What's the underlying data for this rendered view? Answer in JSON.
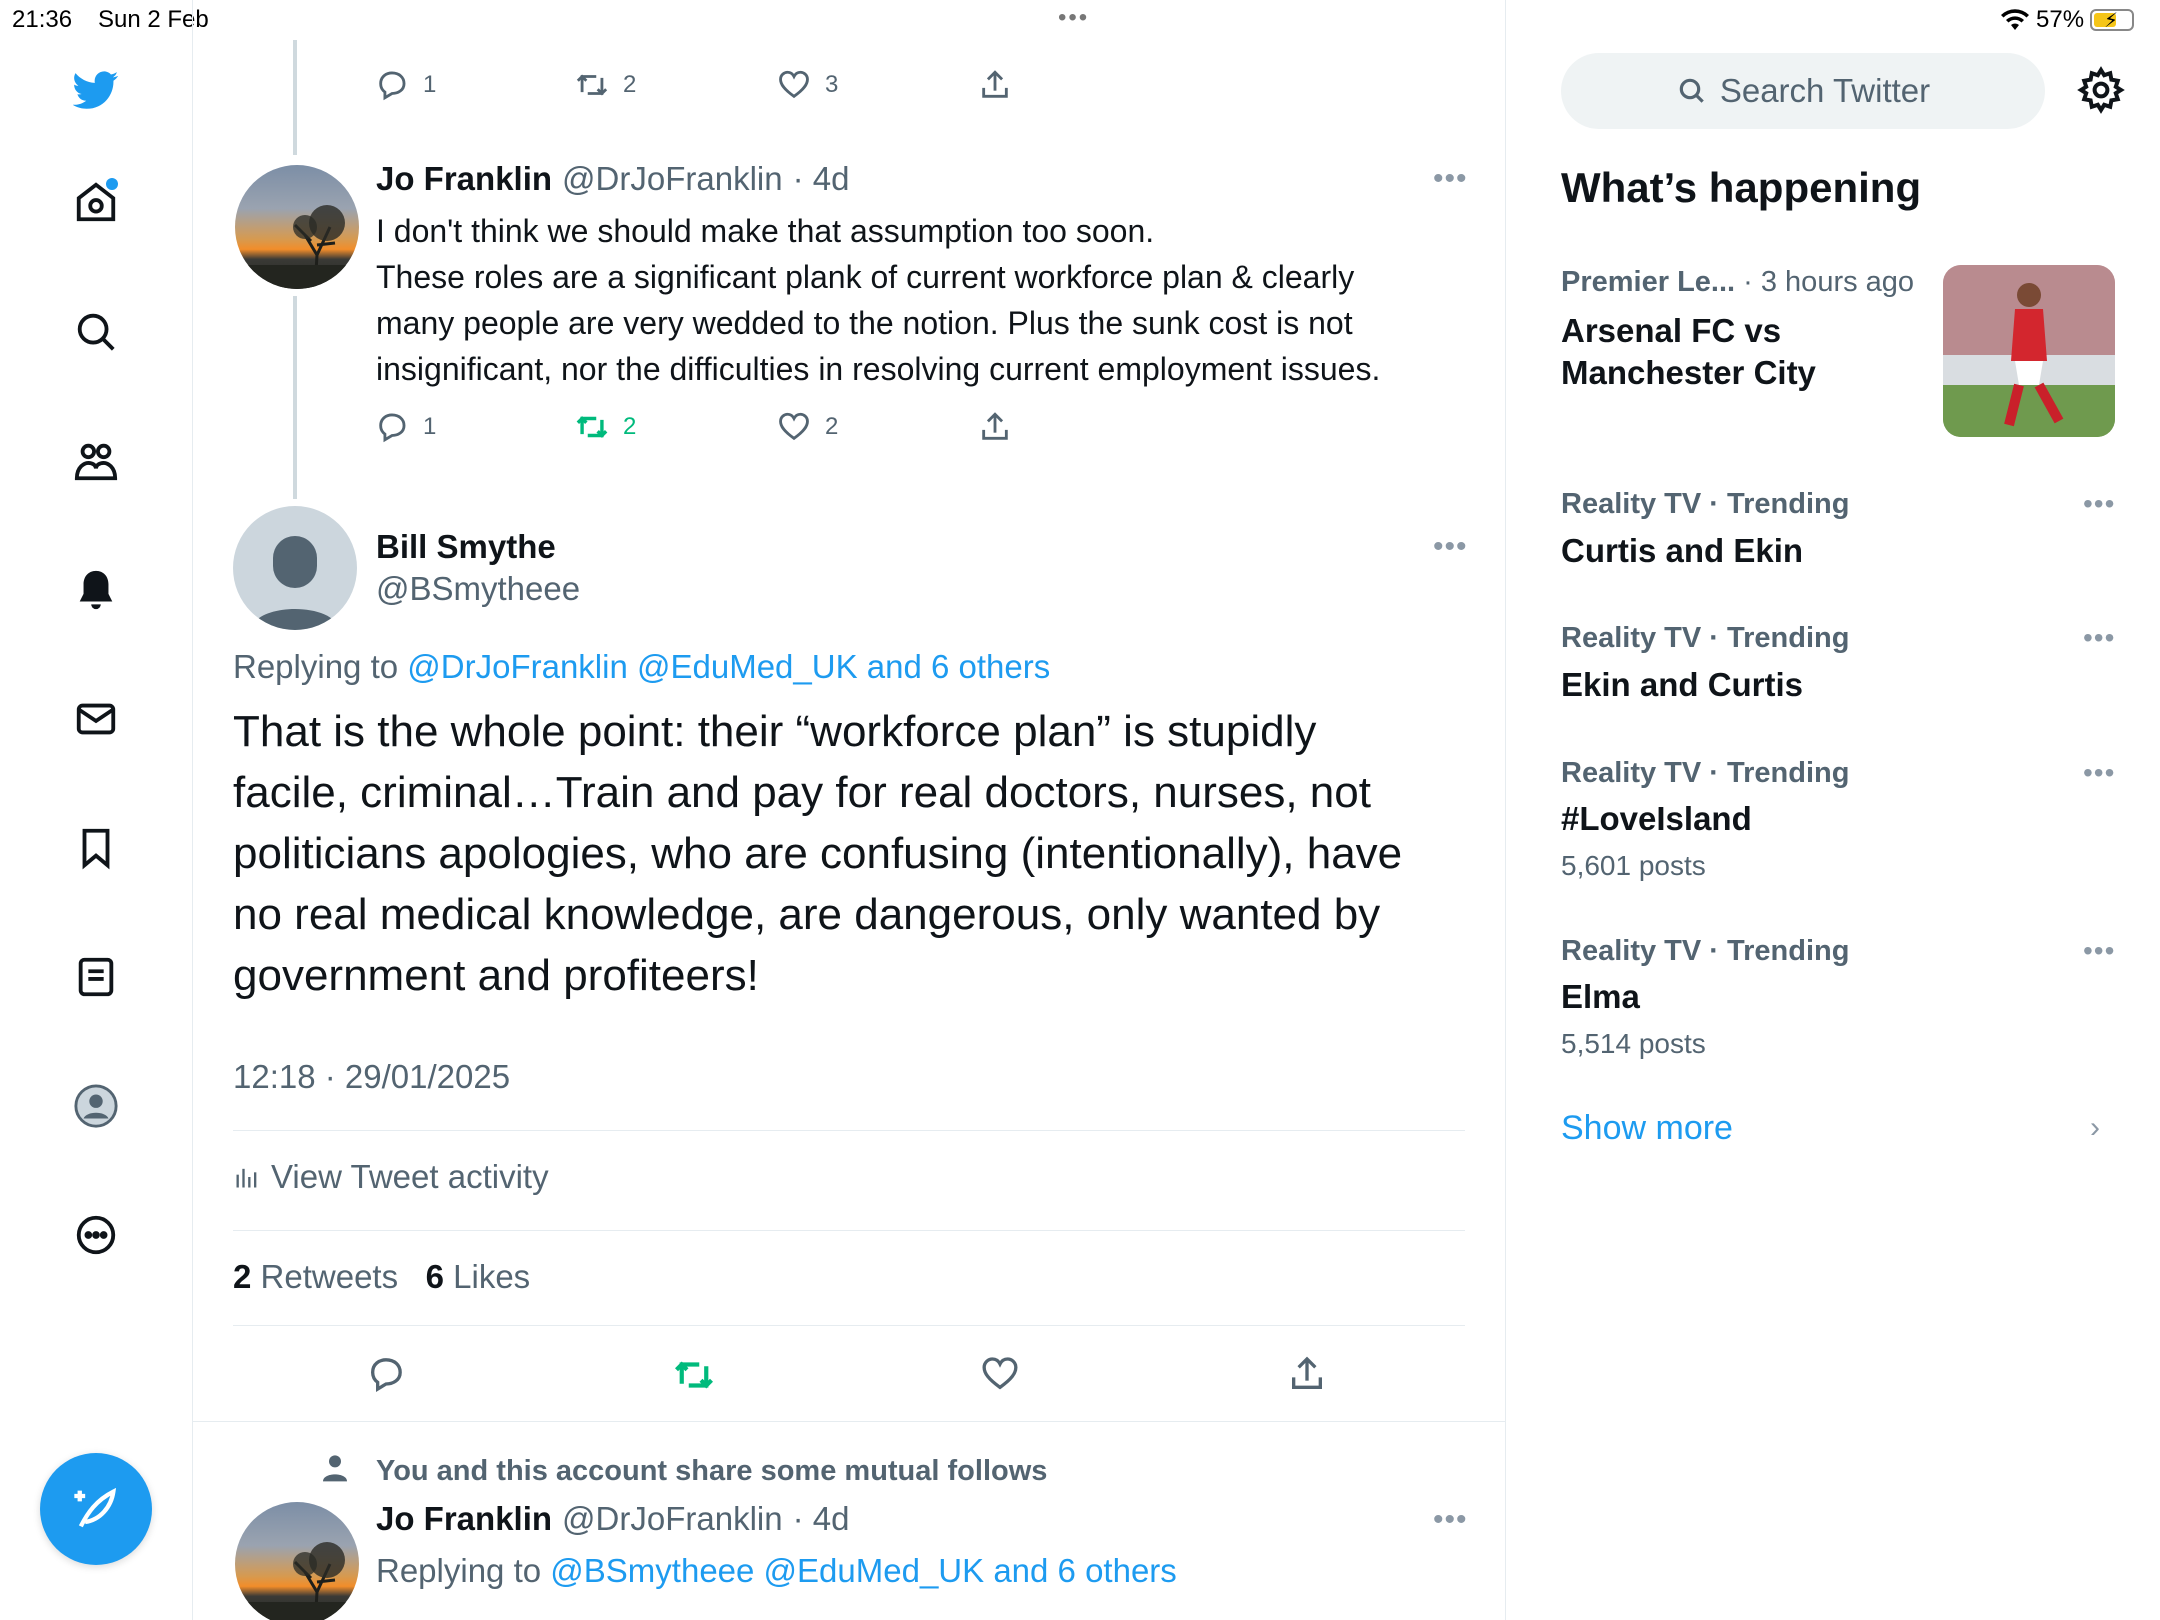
{
  "status_bar": {
    "time": "21:36",
    "date": "Sun 2 Feb",
    "dots": "•••",
    "battery": "57%"
  },
  "nav": {
    "items": [
      "twitter-logo",
      "home",
      "explore",
      "communities",
      "notifications",
      "messages",
      "bookmarks",
      "lists",
      "profile",
      "more"
    ]
  },
  "top_actions": {
    "reply_count": "1",
    "retweet_count": "2",
    "like_count": "3"
  },
  "reply1": {
    "name": "Jo Franklin",
    "handle": "@DrJoFranklin",
    "time": "· 4d",
    "more": "•••",
    "lines": [
      "I don't think we should make that assumption too soon.",
      "These roles are a significant plank of current workforce plan & clearly",
      "many people are very wedded to the notion. Plus the sunk cost is not",
      "insignificant, nor the difficulties in resolving current employment issues."
    ],
    "reply_count": "1",
    "retweet_count": "2",
    "like_count": "2"
  },
  "main_tweet": {
    "name": "Bill Smythe",
    "handle": "@BSmytheee",
    "more": "•••",
    "replying_prefix": "Replying to",
    "replying_to": "@DrJoFranklin @EduMed_UK and 6 others",
    "lines": [
      "That is the whole point: their “workforce plan” is stupidly",
      "facile, criminal…Train and pay for real doctors, nurses, not",
      "politicians apologies, who are confusing (intentionally), have",
      "no real medical knowledge, are dangerous, only wanted by",
      "government and profiteers!"
    ],
    "timestamp": "12:18 · 29/01/2025",
    "activity": "View Tweet activity",
    "retweets_num": "2",
    "retweets_label": "Retweets",
    "likes_num": "6",
    "likes_label": "Likes"
  },
  "reply2": {
    "social_context": "You and this account share some mutual follows",
    "name": "Jo Franklin",
    "handle": "@DrJoFranklin",
    "time": "· 4d",
    "more": "•••",
    "replying_prefix": "Replying to",
    "replying_to": "@BSmytheee @EduMed_UK and 6 others"
  },
  "sidebar": {
    "search_placeholder": "Search Twitter",
    "section_title": "What’s happening",
    "trends": [
      {
        "category": "Premier Le...",
        "context": "· 3 hours ago",
        "title_lines": [
          "Arsenal FC vs",
          "Manchester City"
        ],
        "posts": ""
      },
      {
        "category": "Reality TV · Trending",
        "title": "Curtis and Ekin",
        "posts": "",
        "more": "•••"
      },
      {
        "category": "Reality TV · Trending",
        "title": "Ekin and Curtis",
        "posts": "",
        "more": "•••"
      },
      {
        "category": "Reality TV · Trending",
        "title": "#LoveIsland",
        "posts": "5,601 posts",
        "more": "•••"
      },
      {
        "category": "Reality TV · Trending",
        "title": "Elma",
        "posts": "5,514 posts",
        "more": "•••"
      }
    ],
    "show_more": "Show more",
    "chevron": "›"
  },
  "colors": {
    "accent": "#1d9bf0",
    "retweet_green": "#00ba7c",
    "text": "#0f1419",
    "secondary": "#536471"
  }
}
